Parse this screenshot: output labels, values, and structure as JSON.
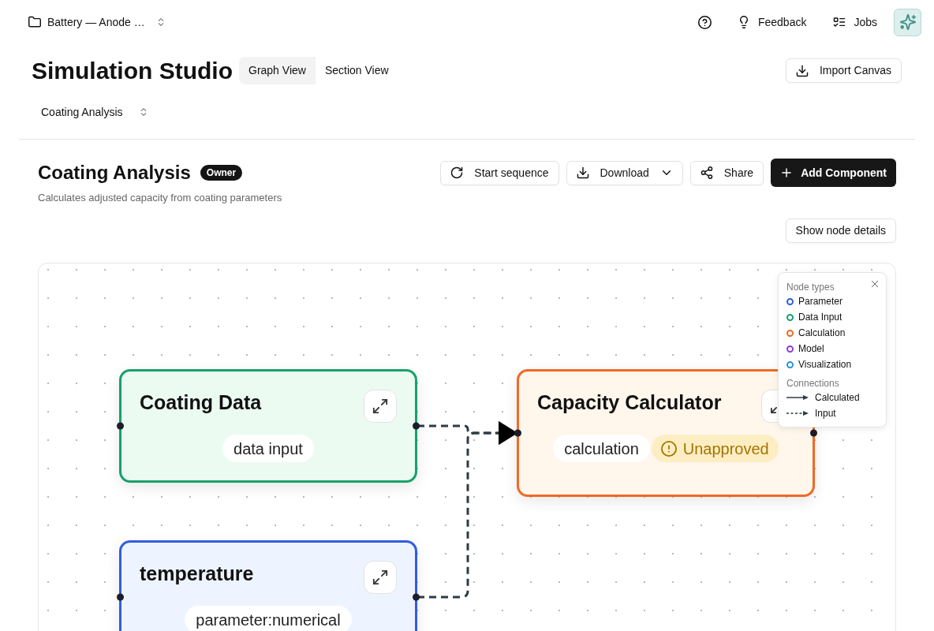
{
  "top_bar": {
    "project": "Battery — Anode …",
    "actions": [
      "Feedback",
      "Jobs"
    ]
  },
  "header": {
    "title": "Simulation Studio",
    "tabs": [
      {
        "label": "Graph View",
        "selected": true
      },
      {
        "label": "Section View",
        "selected": false
      }
    ],
    "import_button": "Import Canvas"
  },
  "flow_selector": "Coating Analysis",
  "section": {
    "title": "Coating Analysis",
    "role_badge": "Owner",
    "description": "Calculates adjusted capacity from coating parameters",
    "actions": [
      {
        "label": "Start sequence",
        "kind": "restart"
      },
      {
        "label": "Download",
        "kind": "download"
      },
      {
        "label": "Share",
        "kind": "share"
      },
      {
        "label": "Add Component",
        "kind": "add"
      }
    ],
    "details_button": "Show node details"
  },
  "canvas": {
    "nodes": [
      {
        "title": "Coating Data",
        "kind": "data_input",
        "tag": "data input"
      },
      {
        "title": "Capacity Calculator",
        "kind": "calculation",
        "tag": "calculation",
        "status": "Unapproved"
      },
      {
        "title": "temperature",
        "kind": "parameter",
        "tag": "parameter:numerical"
      }
    ],
    "edges": [
      {
        "kind": "input"
      },
      {
        "kind": "input"
      }
    ],
    "legend": {
      "title": "Node types",
      "node_types": [
        {
          "label": "Parameter",
          "color": "#2f5de0"
        },
        {
          "label": "Data Input",
          "color": "#17a06c"
        },
        {
          "label": "Calculation",
          "color": "#ef6a23"
        },
        {
          "label": "Model",
          "color": "#8a3fd6"
        },
        {
          "label": "Visualization",
          "color": "#2a93d5"
        }
      ],
      "connections_title": "Connections",
      "connections": [
        {
          "label": "Calculated",
          "kind": "calculated"
        },
        {
          "label": "Input",
          "kind": "input"
        }
      ]
    }
  }
}
